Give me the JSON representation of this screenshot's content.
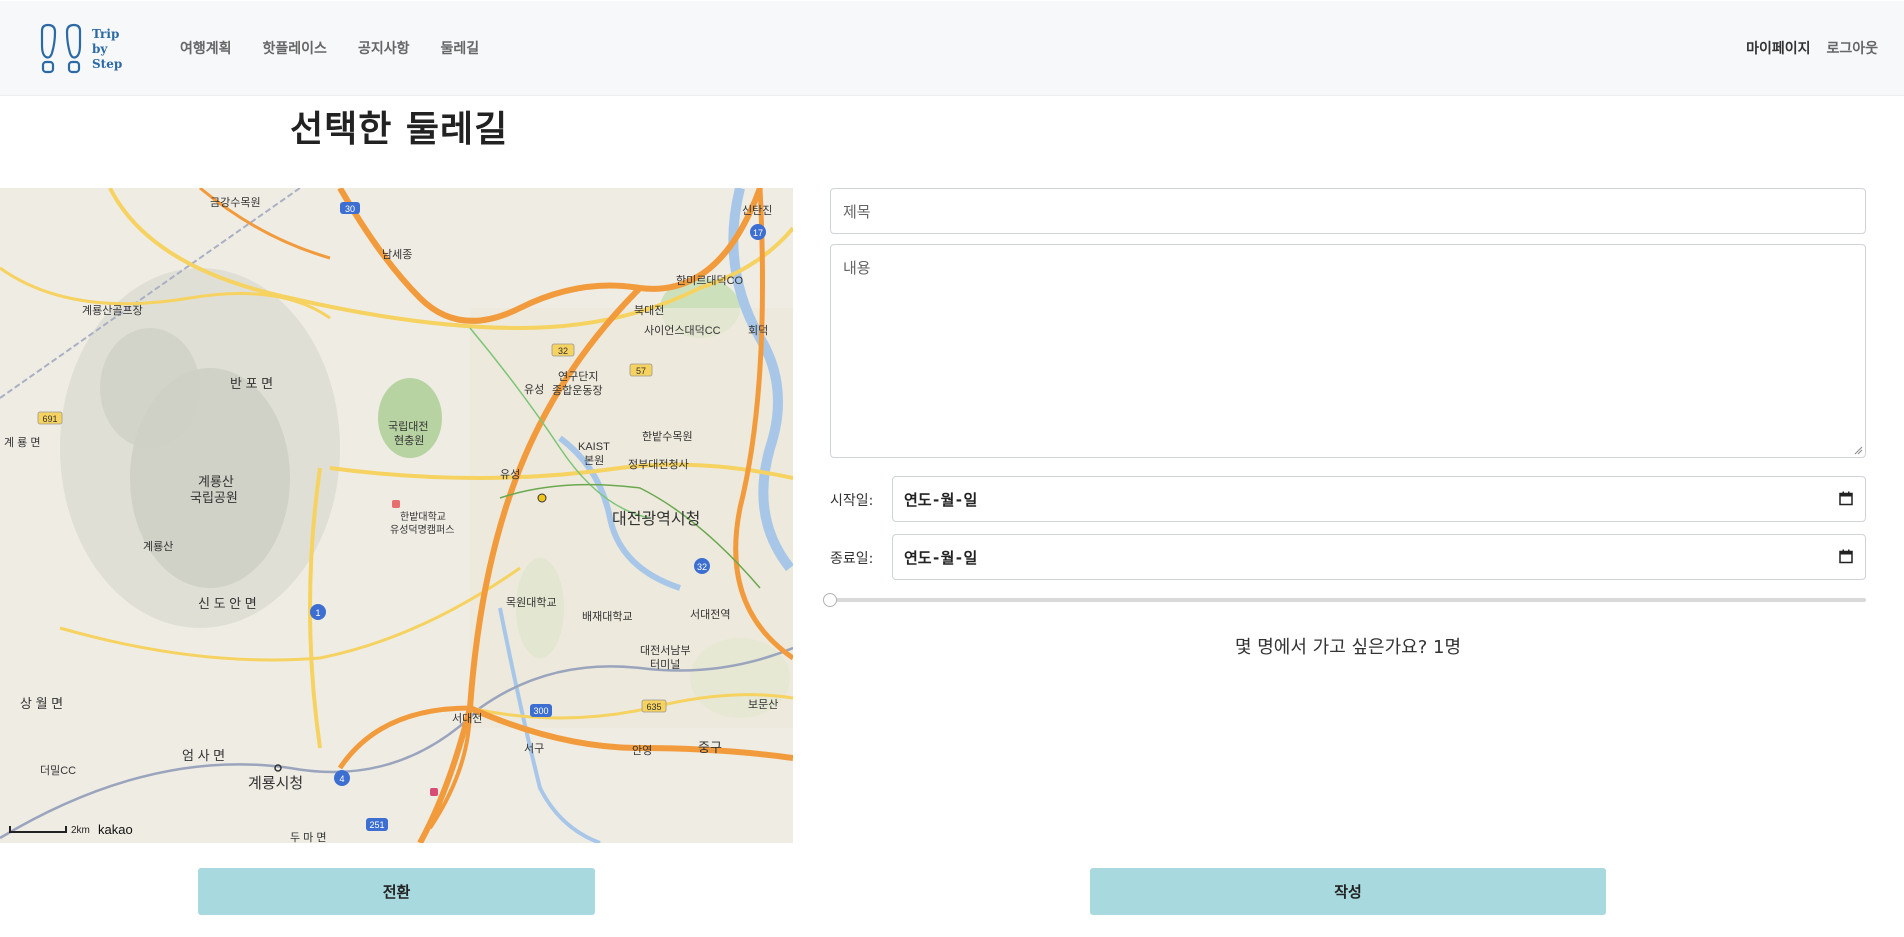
{
  "logo": {
    "line1": "Trip",
    "line2": "by",
    "line3": "Step"
  },
  "nav": {
    "items": [
      {
        "label": "여행계획"
      },
      {
        "label": "핫플레이스"
      },
      {
        "label": "공지사항"
      },
      {
        "label": "둘레길"
      }
    ],
    "mypage": "마이페이지",
    "logout": "로그아웃"
  },
  "page": {
    "title": "선택한 둘레길"
  },
  "map": {
    "scale_label": "2km",
    "brand": "kakao",
    "places": [
      "금강수목원",
      "남세종",
      "계룡산골프장",
      "반포면",
      "계룡면",
      "국립대전현충원",
      "계룡산",
      "국립공원",
      "한밭대학교",
      "유성덕명캠퍼스",
      "신도안면",
      "상월면",
      "엄사면",
      "계룡시청",
      "두마면",
      "더밀CC",
      "연구단지",
      "종합운동장",
      "유성",
      "북대전",
      "사이언스대덕CC",
      "한미르대덕CO",
      "KAIST",
      "본원",
      "한밭수목원",
      "정부대전청사",
      "대전광역시청",
      "목원대학교",
      "배재대학교",
      "서대전역",
      "대전서남부",
      "터미널",
      "서대전",
      "서구",
      "안영",
      "중구",
      "보문산",
      "신탄진",
      "회덕"
    ],
    "roads": [
      "30",
      "17",
      "32",
      "57",
      "691",
      "1",
      "4",
      "635",
      "300",
      "251"
    ]
  },
  "form": {
    "title_placeholder": "제목",
    "content_placeholder": "내용",
    "start_label": "시작일:",
    "end_label": "종료일:",
    "date_placeholder": "연도-월-일",
    "people_text": "몇 명에서 가고 싶은가요? 1명",
    "people_value": 1
  },
  "buttons": {
    "switch": "전환",
    "write": "작성"
  },
  "colors": {
    "nav_bg": "#f7f8fa",
    "button_bg": "#a8d9df",
    "logo_blue": "#2c6aa5",
    "road_orange": "#f29b3c",
    "road_yellow": "#f6d260"
  }
}
